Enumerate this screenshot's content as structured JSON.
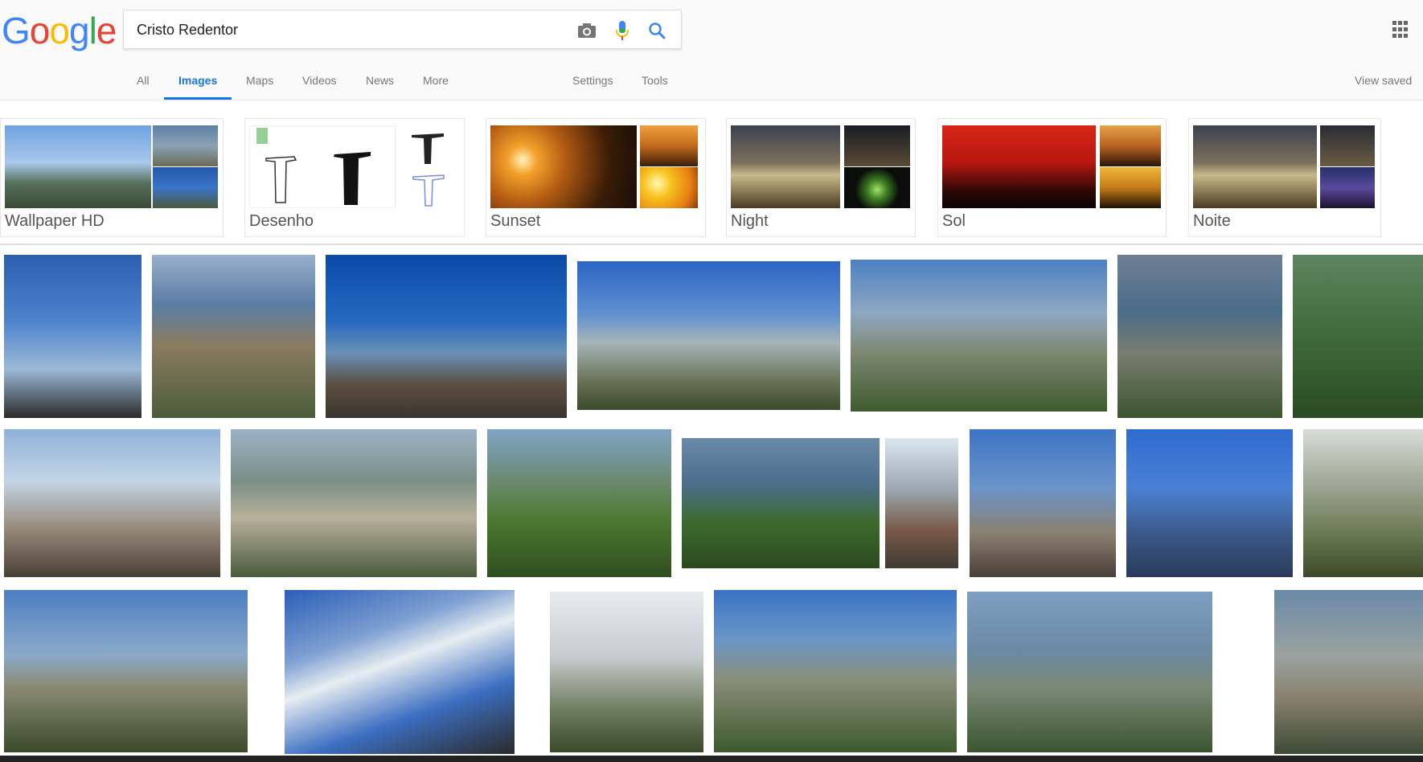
{
  "logo": {
    "text": [
      "G",
      "o",
      "o",
      "g",
      "l",
      "e"
    ],
    "colors": [
      "#4285F4",
      "#EA4335",
      "#FBBC05",
      "#4285F4",
      "#34A853",
      "#EA4335"
    ]
  },
  "search": {
    "value": "Cristo Redentor",
    "placeholder": ""
  },
  "icons": {
    "camera": "camera-icon",
    "mic": "microphone-icon",
    "search": "search-icon",
    "apps": "apps-grid-icon"
  },
  "tabs": [
    {
      "label": "All"
    },
    {
      "label": "Images"
    },
    {
      "label": "Maps"
    },
    {
      "label": "Videos"
    },
    {
      "label": "News"
    },
    {
      "label": "More"
    },
    {
      "label": "Settings"
    },
    {
      "label": "Tools"
    }
  ],
  "view_saved": "View saved",
  "suggestions": [
    {
      "label": "Wallpaper HD"
    },
    {
      "label": "Desenho"
    },
    {
      "label": "Sunset"
    },
    {
      "label": "Night"
    },
    {
      "label": "Sol"
    },
    {
      "label": "Noite"
    }
  ],
  "colors": {
    "accent": "#1a73e8",
    "tab_text": "#777777",
    "chip_label": "#555555"
  }
}
